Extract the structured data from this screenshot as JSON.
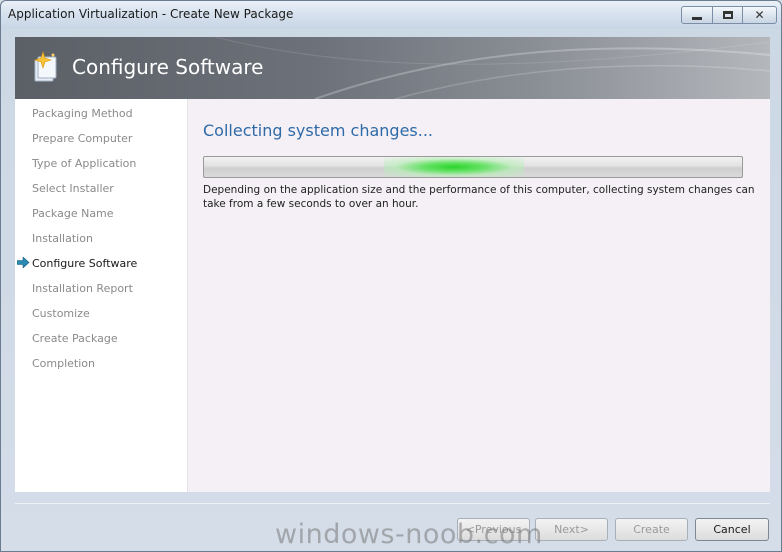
{
  "window": {
    "title": "Application Virtualization - Create New Package",
    "controls": {
      "minimize_icon": "minimize-icon",
      "maximize_icon": "maximize-icon",
      "close_icon": "close-icon"
    }
  },
  "banner": {
    "icon": "wizard-sparkle-icon",
    "title": "Configure Software"
  },
  "sidebar": {
    "items": [
      {
        "label": "Packaging Method"
      },
      {
        "label": "Prepare Computer"
      },
      {
        "label": "Type of Application"
      },
      {
        "label": "Select Installer"
      },
      {
        "label": "Package Name"
      },
      {
        "label": "Installation"
      },
      {
        "label": "Configure Software",
        "active": true
      },
      {
        "label": "Installation Report"
      },
      {
        "label": "Customize"
      },
      {
        "label": "Create Package"
      },
      {
        "label": "Completion"
      }
    ],
    "current_indicator_icon": "arrow-right-icon"
  },
  "main": {
    "heading": "Collecting system changes...",
    "progress": {
      "state": "indeterminate",
      "glow_color": "#2bd42b"
    },
    "description": "Depending on the application size and the performance of this computer, collecting system changes can take from a few seconds to over an hour."
  },
  "footer": {
    "previous_label": "<Previous",
    "next_label": "Next>",
    "create_label": "Create",
    "cancel_label": "Cancel",
    "previous_enabled": false,
    "next_enabled": false,
    "create_enabled": false,
    "cancel_enabled": true
  },
  "watermark": "windows-noob.com",
  "colors": {
    "heading": "#2e6aa8",
    "banner": "#6d7179",
    "nav_inactive": "#8a8a8a",
    "nav_active": "#1a1a1a",
    "main_bg": "#f4f0f5"
  }
}
